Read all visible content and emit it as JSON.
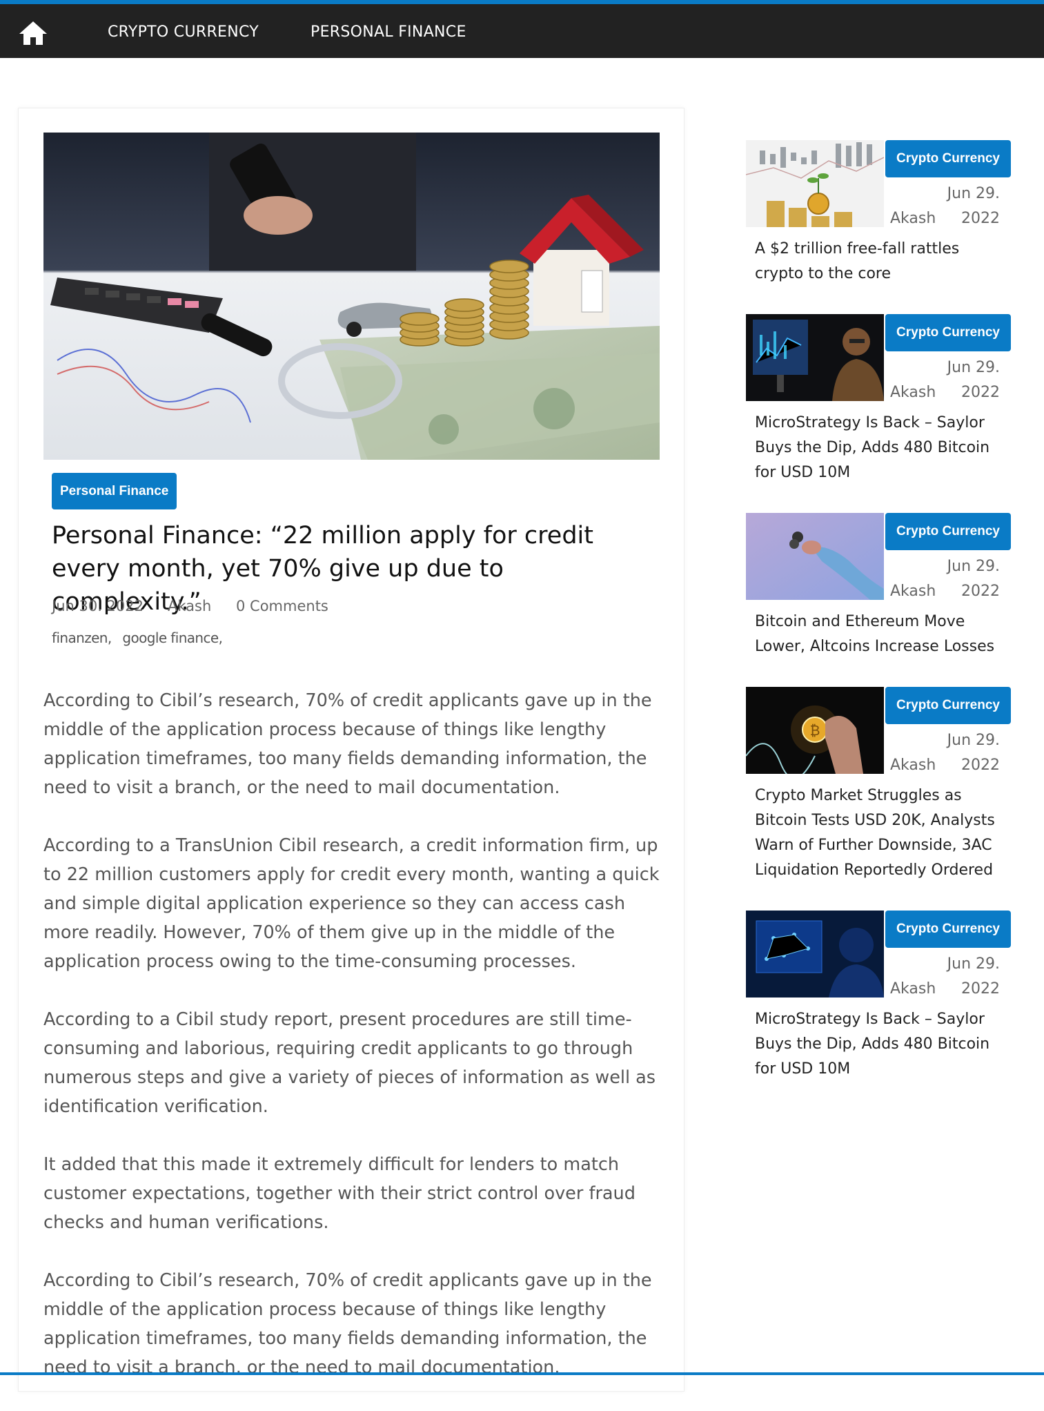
{
  "nav": {
    "home_icon": "home-icon",
    "items": [
      {
        "label": "CRYPTO CURRENCY"
      },
      {
        "label": "PERSONAL FINANCE"
      }
    ]
  },
  "article": {
    "image": "finance-hero-image",
    "category": "Personal Finance",
    "title": "Personal Finance: “22 million apply for credit every month, yet 70% give up due to complexity.”",
    "date": "Jun 30. 2022",
    "author": "Akash",
    "comments": "0 Comments",
    "tags": [
      "finanzen,",
      "google finance,"
    ],
    "paragraphs": [
      "According to Cibil’s research, 70% of credit applicants gave up in the middle of the application process because of things like lengthy application timeframes, too many fields demanding information, the need to visit a branch, or the need to mail documentation.",
      "According to a TransUnion Cibil research, a credit information firm, up to 22 million customers apply for credit every month, wanting a quick and simple digital application experience so they can access cash more readily. However, 70% of them give up in the middle of the application process owing to the time-consuming processes.",
      "According to a Cibil study report, present procedures are still time-consuming and laborious, requiring credit applicants to go through numerous steps and give a variety of pieces of information as well as identification verification.",
      "It added that this made it extremely difficult for lenders to match customer expectations, together with their strict control over fraud checks and human verifications.",
      "According to Cibil’s research, 70% of credit applicants gave up in the middle of the application process because of things like lengthy application timeframes, too many fields demanding information, the need to visit a branch, or the need to mail documentation."
    ]
  },
  "sidebar": {
    "posts": [
      {
        "category": "Crypto Currency",
        "date": "Jun 29. 2022",
        "author": "Akash",
        "title": "A $2 trillion free-fall rattles crypto to the core",
        "thumb": "bitcoin-chart-thumbnail"
      },
      {
        "category": "Crypto Currency",
        "date": "Jun 29. 2022",
        "author": "Akash",
        "title": "MicroStrategy Is Back – Saylor Buys the Dip, Adds 480 Bitcoin for USD 10M",
        "thumb": "trader-monitor-thumbnail"
      },
      {
        "category": "Crypto Currency",
        "date": "Jun 29. 2022",
        "author": "Akash",
        "title": "Bitcoin and Ethereum Move Lower, Altcoins Increase Losses",
        "thumb": "hand-coin-thumbnail"
      },
      {
        "category": "Crypto Currency",
        "date": "Jun 29. 2022",
        "author": "Akash",
        "title": "Crypto Market Struggles as Bitcoin Tests USD 20K, Analysts Warn of Further Downside, 3AC Liquidation Reportedly Ordered",
        "thumb": "bitcoin-glow-thumbnail"
      },
      {
        "category": "Crypto Currency",
        "date": "Jun 29. 2022",
        "author": "Akash",
        "title": "MicroStrategy Is Back – Saylor Buys the Dip, Adds 480 Bitcoin for USD 10M",
        "thumb": "network-screen-thumbnail"
      }
    ]
  },
  "colors": {
    "accent": "#0a7bc6",
    "navbar": "#222222"
  }
}
